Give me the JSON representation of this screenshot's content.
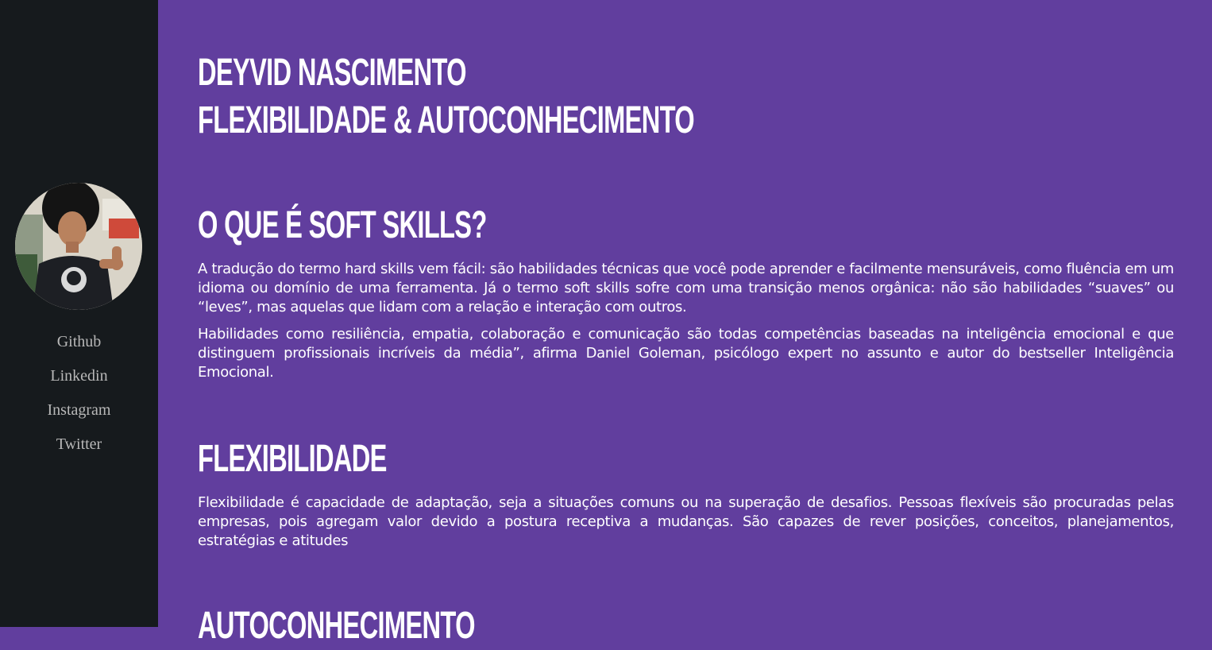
{
  "sidebar": {
    "avatar_alt": "Deyvid Nascimento",
    "links": [
      {
        "label": "Github"
      },
      {
        "label": "Linkedin"
      },
      {
        "label": "Instagram"
      },
      {
        "label": "Twitter"
      }
    ]
  },
  "header": {
    "name": "Deyvid Nascimento",
    "subtitle": "Flexibilidade & Autoconhecimento"
  },
  "sections": [
    {
      "heading": "O que é Soft Skills?",
      "paragraphs": [
        "A tradução do termo hard skills vem fácil: são habilidades técnicas que você pode aprender e facilmente mensuráveis, como fluência em um idioma ou domínio de uma ferramenta. Já o termo soft skills sofre com uma transição menos orgânica: não são habilidades “suaves” ou “leves”, mas aquelas que lidam com a relação e interação com outros.",
        "Habilidades como resiliência, empatia, colaboração e comunicação são todas competências baseadas na inteligência emocional e que distinguem profissionais incríveis da média”, afirma Daniel Goleman, psicólogo expert no assunto e autor do bestseller Inteligência Emocional."
      ]
    },
    {
      "heading": "Flexibilidade",
      "paragraphs": [
        "Flexibilidade é capacidade de adaptação, seja a situações comuns ou na superação de desafios. Pessoas flexíveis são procuradas pelas empresas, pois agregam valor devido a postura receptiva a mudanças. São capazes de rever posições, conceitos, planejamentos, estratégias e atitudes"
      ]
    },
    {
      "heading": "Autoconhecimento",
      "paragraphs": []
    }
  ]
}
